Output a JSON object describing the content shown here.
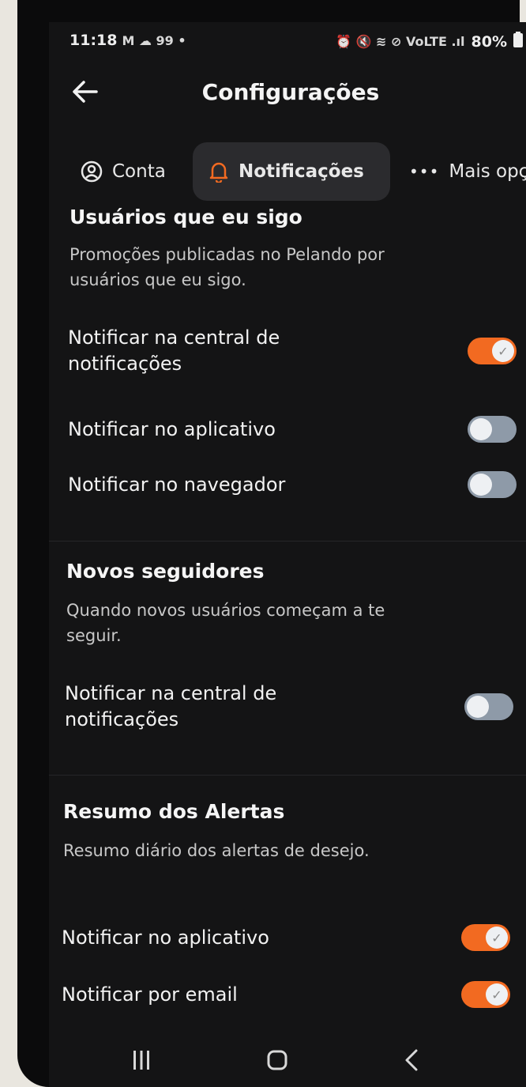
{
  "status_bar": {
    "time": "11:18",
    "left_icons": "M ☁ 99 •",
    "right_icons": "⏰ 🔇 ≋ ⊘ VoLTE .ıl",
    "battery": "80%"
  },
  "header": {
    "title": "Configurações"
  },
  "tabs": [
    {
      "label": "Conta",
      "icon": "user-circle-icon"
    },
    {
      "label": "Notificações",
      "icon": "bell-icon"
    },
    {
      "label": "Mais opçõ",
      "icon": "more-dots-icon"
    }
  ],
  "sections": {
    "following": {
      "title": "Usuários que eu sigo",
      "description_line1": "Promoções publicadas no Pelando por",
      "description_line2": "usuários que eu sigo.",
      "options": [
        {
          "label_line1": "Notificar na central de",
          "label_line2": "notificações",
          "on": true
        },
        {
          "label": "Notificar no aplicativo",
          "on": false
        },
        {
          "label": "Notificar no navegador",
          "on": false
        }
      ]
    },
    "new_followers": {
      "title": "Novos seguidores",
      "description_line1": "Quando novos usuários começam a te",
      "description_line2": "seguir.",
      "options": [
        {
          "label_line1": "Notificar na central de",
          "label_line2": "notificações",
          "on": false
        }
      ]
    },
    "alerts_summary": {
      "title": "Resumo dos Alertas",
      "description": "Resumo diário dos alertas de desejo.",
      "options": [
        {
          "label": "Notificar no aplicativo",
          "on": true
        },
        {
          "label": "Notificar por email",
          "on": true
        }
      ]
    }
  },
  "colors": {
    "accent": "#f26a21",
    "background": "#141415",
    "toggle_off": "#8e9aa8"
  },
  "nav": {
    "recents_icon": "recents-icon",
    "home_icon": "home-icon",
    "back_icon": "back-chevron-icon"
  }
}
